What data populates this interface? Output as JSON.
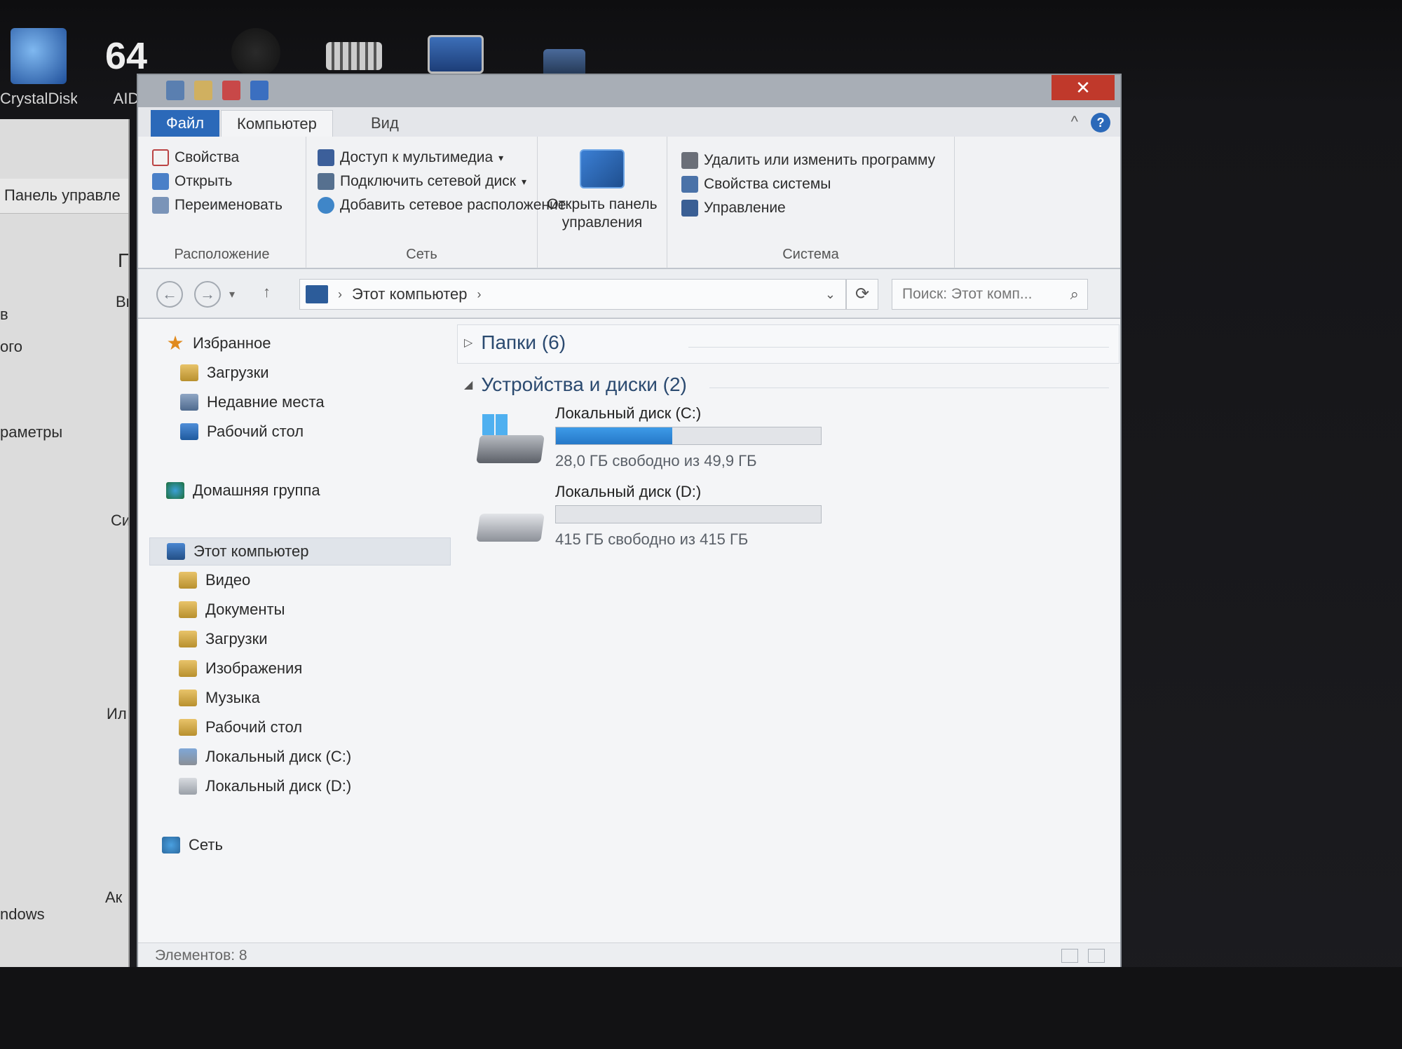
{
  "desktop": {
    "icons": [
      {
        "label": "CrystalDisk..."
      },
      {
        "label": "AID"
      }
    ]
  },
  "background_window": {
    "breadcrumb": "Панель управле",
    "fragments": [
      "П",
      "Вы",
      "в",
      "ого",
      "раметры",
      "Си",
      "Ил",
      "Ак",
      "ndows"
    ]
  },
  "window": {
    "close_label": "✕",
    "tabs": {
      "file": "Файл",
      "computer": "Компьютер",
      "view": "Вид"
    },
    "help_label": "?",
    "ribbon": {
      "location": {
        "label": "Расположение",
        "items": [
          "Свойства",
          "Открыть",
          "Переименовать"
        ]
      },
      "network": {
        "label": "Сеть",
        "items": [
          "Доступ к мультимедиа",
          "Подключить сетевой диск",
          "Добавить сетевое расположение"
        ]
      },
      "control_panel": {
        "line1": "Открыть панель",
        "line2": "управления"
      },
      "system": {
        "label": "Система",
        "items": [
          "Удалить или изменить программу",
          "Свойства системы",
          "Управление"
        ]
      }
    },
    "address": {
      "path": "Этот компьютер",
      "search_placeholder": "Поиск: Этот комп..."
    },
    "tree": {
      "favorites": "Избранное",
      "fav_items": [
        "Загрузки",
        "Недавние места",
        "Рабочий стол"
      ],
      "homegroup": "Домашняя группа",
      "this_pc": "Этот компьютер",
      "pc_items": [
        "Видео",
        "Документы",
        "Загрузки",
        "Изображения",
        "Музыка",
        "Рабочий стол",
        "Локальный диск (C:)",
        "Локальный диск (D:)"
      ],
      "network": "Сеть"
    },
    "main": {
      "folders_group": "Папки (6)",
      "devices_group": "Устройства и диски (2)",
      "drives": [
        {
          "name": "Локальный диск (C:)",
          "free_text": "28,0 ГБ свободно из 49,9 ГБ",
          "used_fraction": 0.44
        },
        {
          "name": "Локальный диск (D:)",
          "free_text": "415 ГБ свободно из 415 ГБ",
          "used_fraction": 0.0
        }
      ]
    },
    "status": {
      "items_count": "Элементов: 8"
    }
  }
}
